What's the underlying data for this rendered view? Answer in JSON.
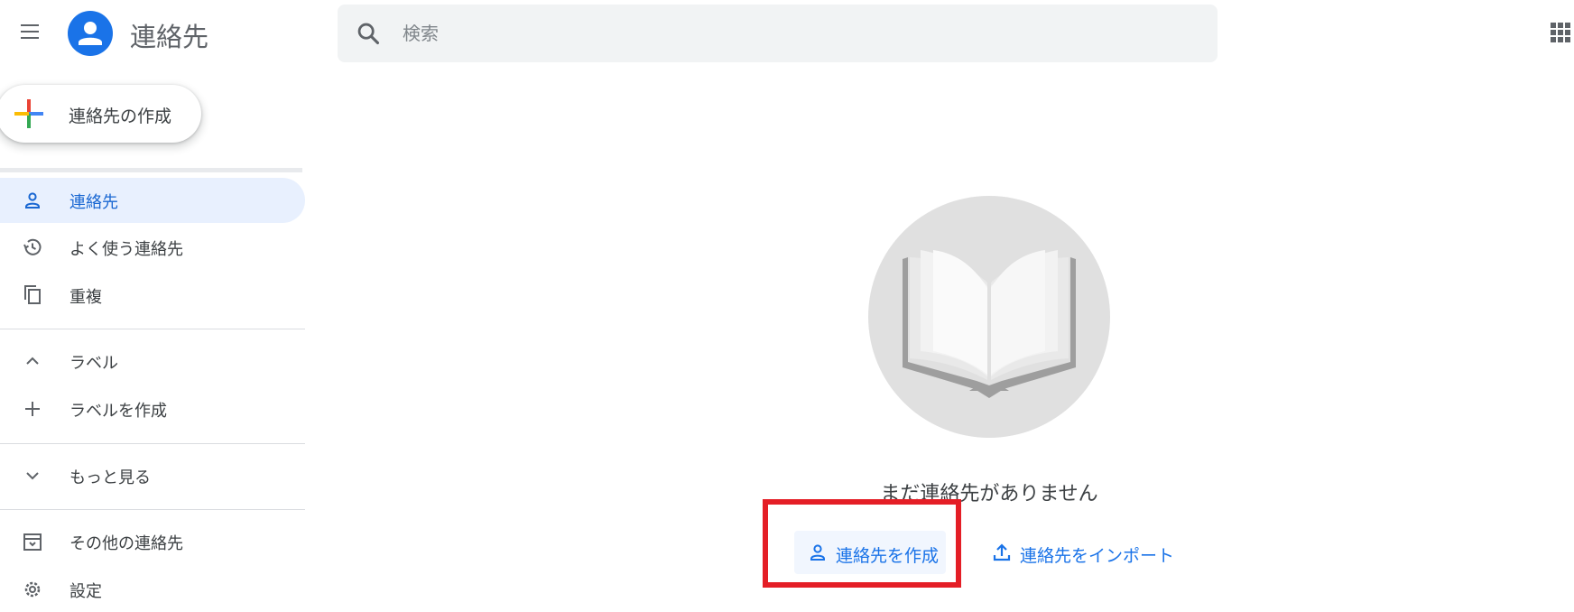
{
  "header": {
    "title": "連絡先",
    "menu_icon": "hamburger-menu-icon",
    "logo_icon": "contacts-person-logo",
    "apps_icon": "google-apps-grid-icon"
  },
  "search": {
    "placeholder": "検索",
    "value": "",
    "icon": "search-icon"
  },
  "create_contact": {
    "label": "連絡先の作成",
    "icon": "multicolor-plus-icon"
  },
  "sidebar": {
    "items": [
      {
        "label": "連絡先",
        "icon": "person-icon",
        "active": true
      },
      {
        "label": "よく使う連絡先",
        "icon": "history-icon"
      },
      {
        "label": "重複",
        "icon": "copy-icon"
      },
      {
        "label": "ラベル",
        "icon": "chevron-up-icon"
      },
      {
        "label": "ラベルを作成",
        "icon": "plus-icon"
      },
      {
        "label": "もっと見る",
        "icon": "chevron-down-icon"
      },
      {
        "label": "その他の連絡先",
        "icon": "archive-icon"
      },
      {
        "label": "設定",
        "icon": "settings-gear-icon"
      }
    ]
  },
  "main": {
    "empty_state": {
      "illustration": "open-book-illustration",
      "message": "まだ連絡先がありません",
      "create_label": "連絡先を作成",
      "import_label": "連絡先をインポート"
    }
  },
  "colors": {
    "accent": "#1a73e8",
    "active_bg": "#e8f0fe",
    "highlight": "#e41e26",
    "search_bg": "#f1f3f4"
  }
}
